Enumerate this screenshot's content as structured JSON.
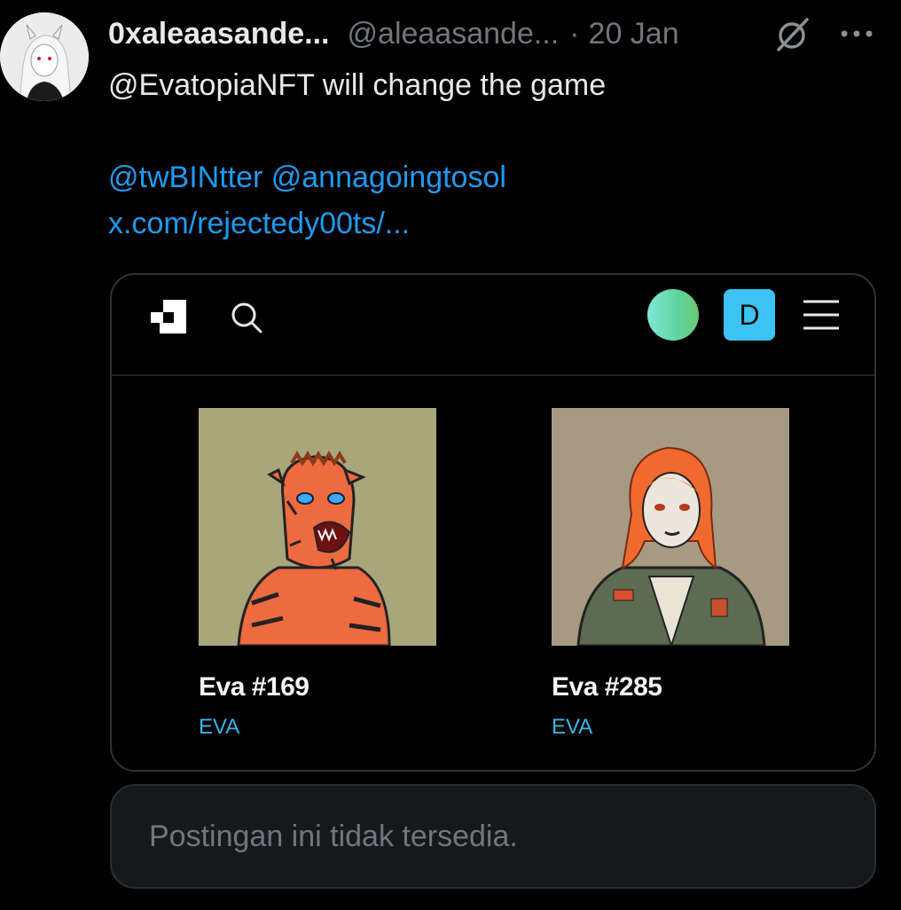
{
  "tweet": {
    "display_name": "0xaleaasande...",
    "handle": "@aleaasande...",
    "separator": "·",
    "date": "20 Jan",
    "text_line1": "@EvatopiaNFT will change the game",
    "mentions": "@twBINtter @annagoingtosol",
    "link": "x.com/rejectedy00ts/...",
    "icons": {
      "grok": "slash-circle-icon",
      "more": "more-dots-icon"
    }
  },
  "card": {
    "nav": {
      "logo": "square-logo-icon",
      "search": "search-icon",
      "profile_letter": "D",
      "menu": "hamburger-icon"
    },
    "nfts": [
      {
        "title": "Eva #169",
        "collection": "EVA"
      },
      {
        "title": "Eva #285",
        "collection": "EVA"
      }
    ],
    "colors": {
      "accent": "#3cc3f4",
      "collection": "#3ab4e8"
    }
  },
  "unavailable_text": "Postingan ini tidak tersedia.",
  "colors": {
    "background": "#000000",
    "link": "#1d9bf0",
    "muted": "#71767b"
  }
}
